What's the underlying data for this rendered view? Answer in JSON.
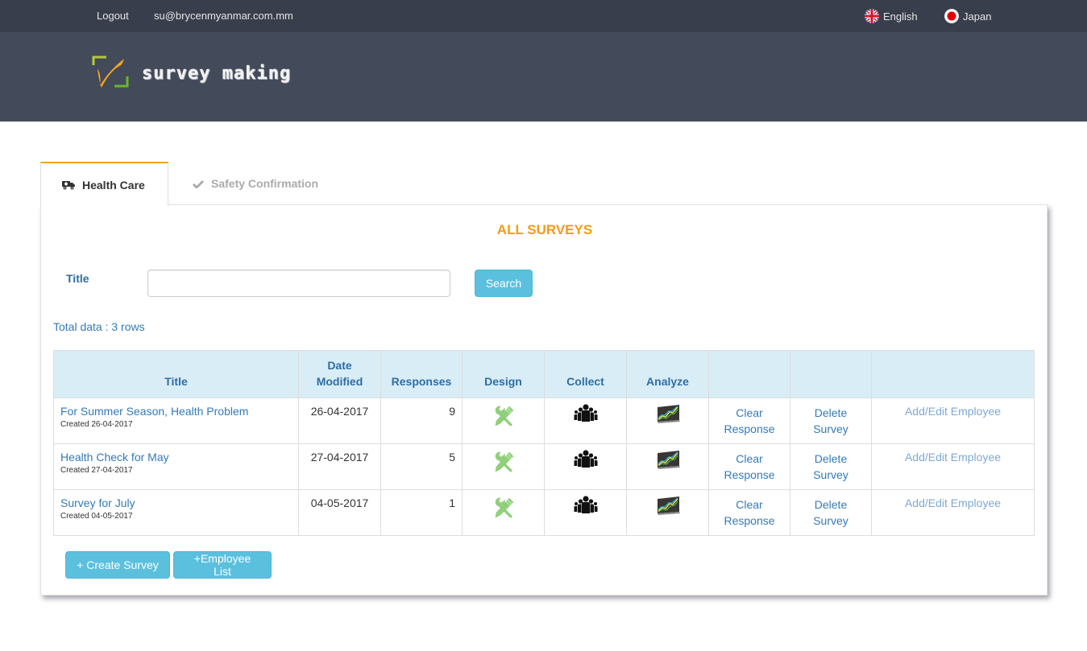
{
  "topbar": {
    "logout_label": "Logout",
    "user_email": "su@brycenmyanmar.com.mm",
    "languages": [
      {
        "label": "English",
        "icon": "uk-flag-icon"
      },
      {
        "label": "Japan",
        "icon": "japan-flag-icon"
      }
    ]
  },
  "header": {
    "logo_text": "survey making",
    "logo_icon": "checkmark-logo-icon"
  },
  "tabs": [
    {
      "label": "Health Care",
      "icon": "ambulance-icon",
      "active": true
    },
    {
      "label": "Safety Confirmation",
      "icon": "check-icon",
      "active": false
    }
  ],
  "panel": {
    "title": "ALL SURVEYS",
    "search": {
      "label": "Title",
      "value": "",
      "placeholder": "",
      "button_label": "Search"
    },
    "total_text": "Total data : 3 rows"
  },
  "table": {
    "columns": [
      "Title",
      "Date Modified",
      "Responses",
      "Design",
      "Collect",
      "Analyze",
      "",
      "",
      ""
    ],
    "column_date_line1": "Date",
    "column_date_line2": "Modified",
    "rows": [
      {
        "title": "For Summer Season, Health Problem",
        "created": "Created 26-04-2017",
        "date_modified": "26-04-2017",
        "responses": "9",
        "design_icon": "tools-icon",
        "collect_icon": "group-icon",
        "analyze_icon": "chart-icon",
        "clear_line1": "Clear",
        "clear_line2": "Response",
        "delete_line1": "Delete",
        "delete_line2": "Survey",
        "employee_label": "Add/Edit Employee"
      },
      {
        "title": "Health Check for May",
        "created": "Created 27-04-2017",
        "date_modified": "27-04-2017",
        "responses": "5",
        "design_icon": "tools-icon",
        "collect_icon": "group-icon",
        "analyze_icon": "chart-icon",
        "clear_line1": "Clear",
        "clear_line2": "Response",
        "delete_line1": "Delete",
        "delete_line2": "Survey",
        "employee_label": "Add/Edit Employee"
      },
      {
        "title": "Survey for July",
        "created": "Created 04-05-2017",
        "date_modified": "04-05-2017",
        "responses": "1",
        "design_icon": "tools-icon",
        "collect_icon": "group-icon",
        "analyze_icon": "chart-icon",
        "clear_line1": "Clear",
        "clear_line2": "Response",
        "delete_line1": "Delete",
        "delete_line2": "Survey",
        "employee_label": "Add/Edit Employee"
      }
    ]
  },
  "buttons": {
    "create_survey": "+ Create Survey",
    "employee_list": "+Employee List"
  },
  "colors": {
    "topbar_bg": "#393e4c",
    "header_bg": "#434a5a",
    "accent_orange": "#f39c12",
    "tab_border": "#f0a30a",
    "link_blue": "#337ab7",
    "table_header_bg": "#d9edf7",
    "button_info": "#5bc0de"
  }
}
